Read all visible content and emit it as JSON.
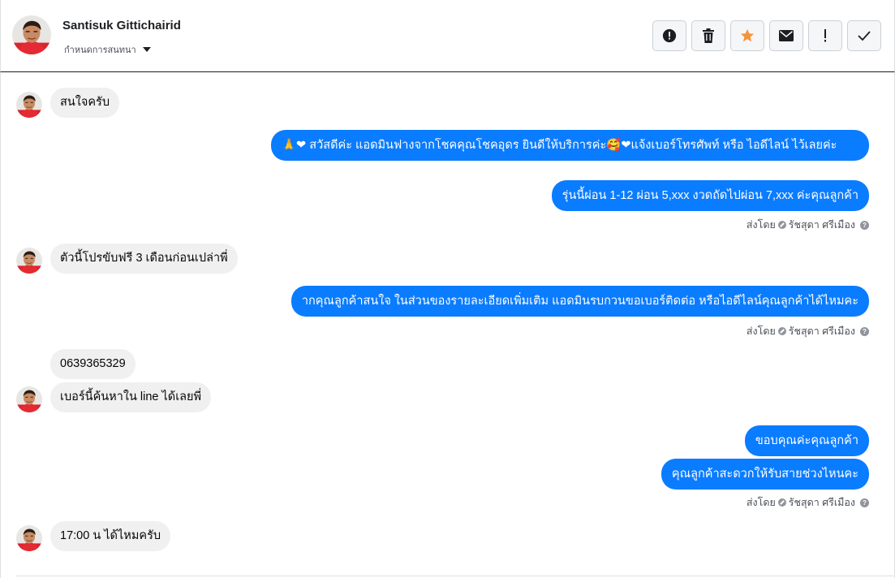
{
  "header": {
    "contact_name": "Santisuk Gittichairid",
    "conversation_setting": "กำหนดการสนทนา",
    "toolbar": [
      {
        "name": "spam-button",
        "icon": "alert-circle-icon"
      },
      {
        "name": "delete-button",
        "icon": "trash-icon"
      },
      {
        "name": "star-button",
        "icon": "star-icon",
        "color": "#f7923b"
      },
      {
        "name": "mark-unread-button",
        "icon": "envelope-icon"
      },
      {
        "name": "important-button",
        "icon": "exclamation-icon"
      },
      {
        "name": "done-button",
        "icon": "check-icon"
      }
    ]
  },
  "colors": {
    "outgoing_bubble": "#0a7cff",
    "incoming_bubble": "#f0f0f0"
  },
  "thread": {
    "msg1": "สนใจครับ",
    "msg2_emoji_a": "🙏❤",
    "msg2_text_a": " สวัสดีค่ะ แอดมินฟางจากโชคคุณโชคอุดร ยินดีให้บริการค่ะ",
    "msg2_emoji_b": "🥰❤",
    "msg2_text_b": "แจ้งเบอร์โทรศัพท์ หรือ ไอดีไลน์  ไว้เลยค่ะ",
    "msg3": "รุ่นนี้ผ่อน 1-12 ผ่อน 5,xxx งวดถัดไปผ่อน 7,xxx ค่ะคุณลูกค้า",
    "sent_by_label": "ส่งโดย",
    "sent_by_name": "รัชสุดา ศรีเมือง",
    "msg4": "ตัวนี้โปรขับฟรี 3 เดือนก่อนเปล่าพี่",
    "msg5": "ากคุณลูกค้าสนใจ ในส่วนของรายละเอียดเพิ่มเติม แอดมินรบกวนขอเบอร์ติดต่อ หรือไอดีไลน์คุณลูกค้าได้ไหมคะ",
    "msg6": "0639365329",
    "msg7": "เบอร์นี้ค้นหาใน line ได้เลยพี่",
    "msg8": "ขอบคุณค่ะคุณลูกค้า",
    "msg9": "คุณลูกค้าสะดวกให้รับสายช่วงไหนคะ",
    "msg10": "17:00 น ได้ไหมครับ"
  }
}
